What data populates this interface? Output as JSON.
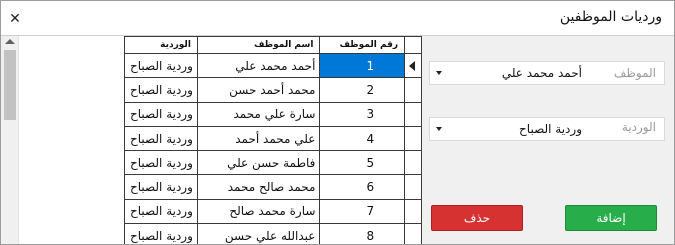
{
  "window": {
    "title": "ورديات الموظفين",
    "close_glyph": "✕"
  },
  "grid": {
    "columns": {
      "id": "رقم الموظف",
      "name": "اسم الموظف",
      "shift": "الوردية"
    },
    "selected_row": 0,
    "rows": [
      {
        "id": "1",
        "name": "أحمد محمد علي",
        "shift": "وردية الصباح"
      },
      {
        "id": "2",
        "name": "محمد أحمد حسن",
        "shift": "وردية الصباح"
      },
      {
        "id": "3",
        "name": "سارة علي محمد",
        "shift": "وردية الصباح"
      },
      {
        "id": "4",
        "name": "علي محمد أحمد",
        "shift": "وردية الصباح"
      },
      {
        "id": "5",
        "name": "فاطمة حسن علي",
        "shift": "وردية الصباح"
      },
      {
        "id": "6",
        "name": "محمد صالح محمد",
        "shift": "وردية الصباح"
      },
      {
        "id": "7",
        "name": "سارة محمد صالح",
        "shift": "وردية الصباح"
      },
      {
        "id": "8",
        "name": "عبدالله علي حسن",
        "shift": "وردية الصباح"
      }
    ]
  },
  "form": {
    "employee": {
      "label": "الموظف",
      "value": "أحمد محمد علي"
    },
    "shift": {
      "label": "الوردية",
      "value": "وردية الصباح"
    }
  },
  "buttons": {
    "delete": "حذف",
    "add": "إضافة"
  },
  "colors": {
    "selection": "#0078d7",
    "delete": "#d63232",
    "add": "#27ae4b",
    "panel": "#f0f0f0"
  }
}
